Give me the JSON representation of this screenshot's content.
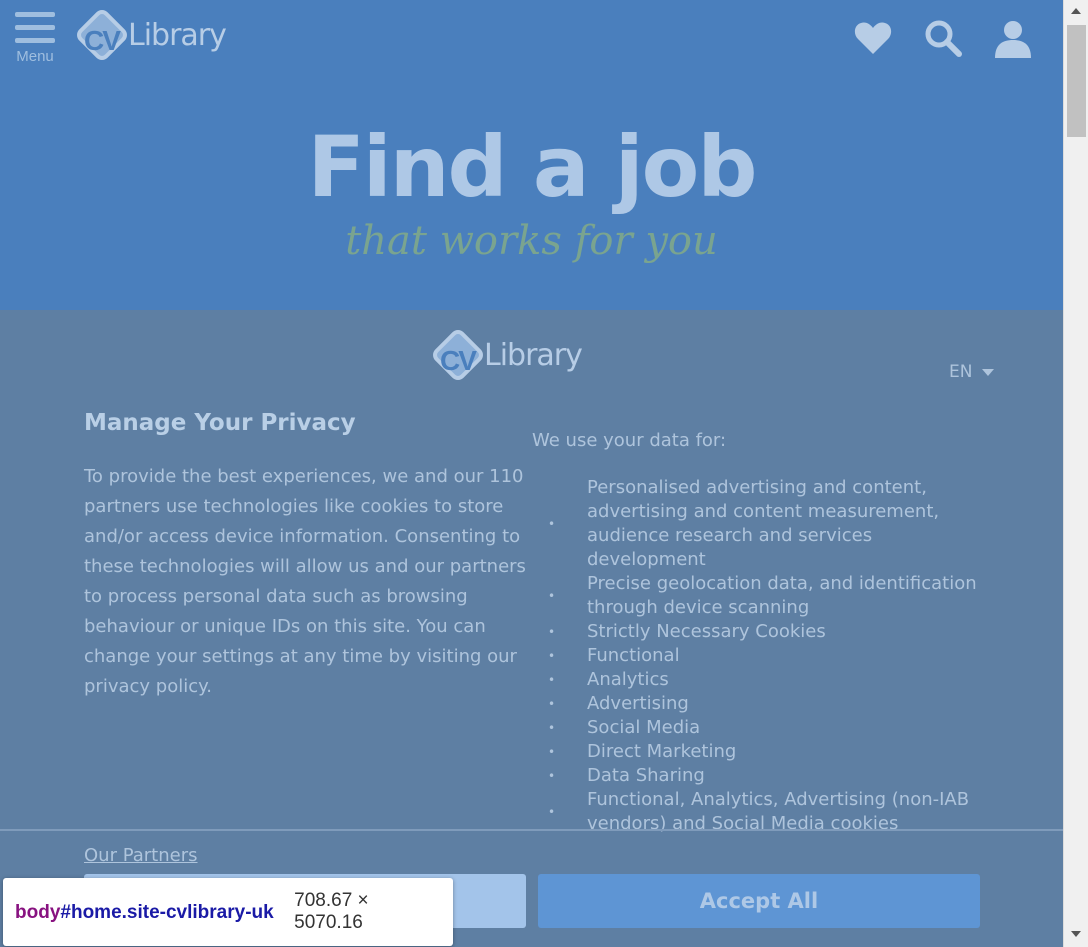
{
  "header": {
    "menu_label": "Menu",
    "logo_cv": "CV",
    "logo_word": "Library",
    "icons": [
      "heart-icon",
      "search-icon",
      "user-icon"
    ]
  },
  "hero": {
    "title": "Find a job",
    "subtitle": "that works for you"
  },
  "consent": {
    "logo_cv": "CV",
    "logo_word": "Library",
    "language": "EN",
    "title": "Manage Your Privacy",
    "description": "To provide the best experiences, we and our 110 partners use technologies like cookies to store and/or access device information. Consenting to these technologies will allow us and our partners to process personal data such as browsing behaviour or unique IDs on this site. You can change your settings at any time by visiting our privacy policy.",
    "uses_title": "We use your data for:",
    "uses": [
      "Personalised advertising and content, advertising and content measurement, audience research and services development",
      "Precise geolocation data, and identification through device scanning",
      "Strictly Necessary Cookies",
      "Functional",
      "Analytics",
      "Advertising",
      "Social Media",
      "Direct Marketing",
      "Data Sharing",
      "Functional, Analytics, Advertising (non-IAB vendors) and Social Media cookies"
    ],
    "partners_link": "Our Partners",
    "accept_label": "Accept All"
  },
  "devtools_tooltip": {
    "selector_tag": "body",
    "selector_rest": "#home.site-cvlibrary-uk",
    "dimensions": "708.67 × 5070.16"
  },
  "colors": {
    "header_bg": "#4a7fbd",
    "overlay_bg": "#5e7fa3",
    "accept_bg": "#5e95d4",
    "hero_sub": "#7aa48f"
  }
}
